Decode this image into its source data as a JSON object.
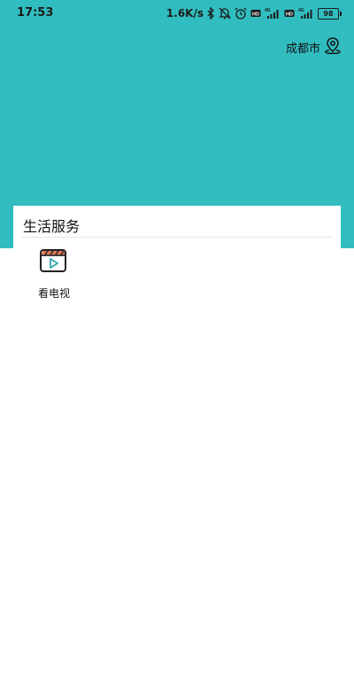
{
  "status_bar": {
    "time": "17:53",
    "network_speed": "1.6K/s",
    "icons": [
      "bluetooth-icon",
      "dnd-off-icon",
      "alarm-icon",
      "hd-icon",
      "signal-4g-icon",
      "hd-icon",
      "signal-4g-icon"
    ],
    "battery_level": "98"
  },
  "header": {
    "background_color": "#31bdc0",
    "location": {
      "city": "成都市",
      "icon": "location-pin-icon"
    }
  },
  "card": {
    "title": "生活服务",
    "items": [
      {
        "label": "看电视",
        "icon": "tv-video-icon"
      }
    ]
  }
}
